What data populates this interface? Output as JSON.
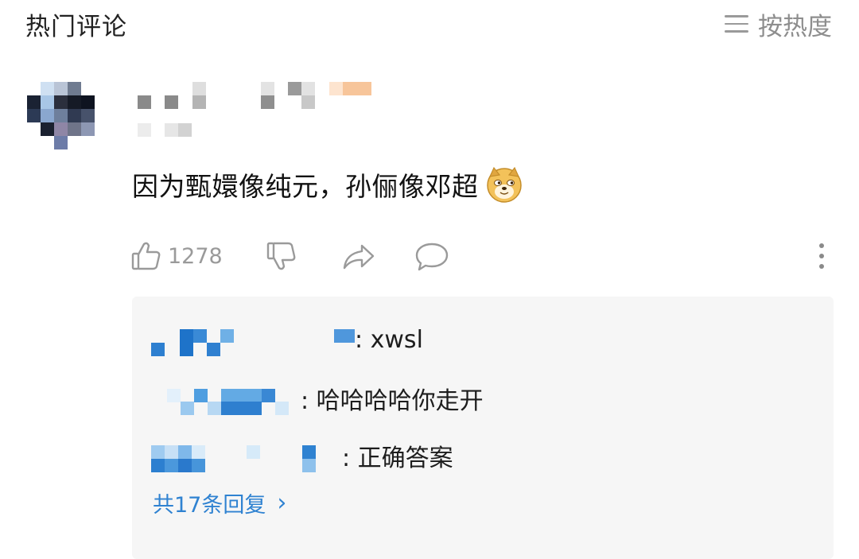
{
  "header": {
    "title": "热门评论",
    "sort_label": "按热度"
  },
  "comment": {
    "text": "因为甄嬛像纯元，孙俪像邓超",
    "emoji": "doge-emoji",
    "like_count": "1278"
  },
  "replies": [
    {
      "text": ": xwsl"
    },
    {
      "text": ": 哈哈哈哈你走开"
    },
    {
      "text": ": 正确答案"
    }
  ],
  "more_replies": {
    "label": "共17条回复",
    "chevron": "›"
  },
  "colors": {
    "link_blue": "#2f82d1",
    "icon_gray": "#9a9a9a",
    "reply_bg": "#f6f6f6"
  }
}
